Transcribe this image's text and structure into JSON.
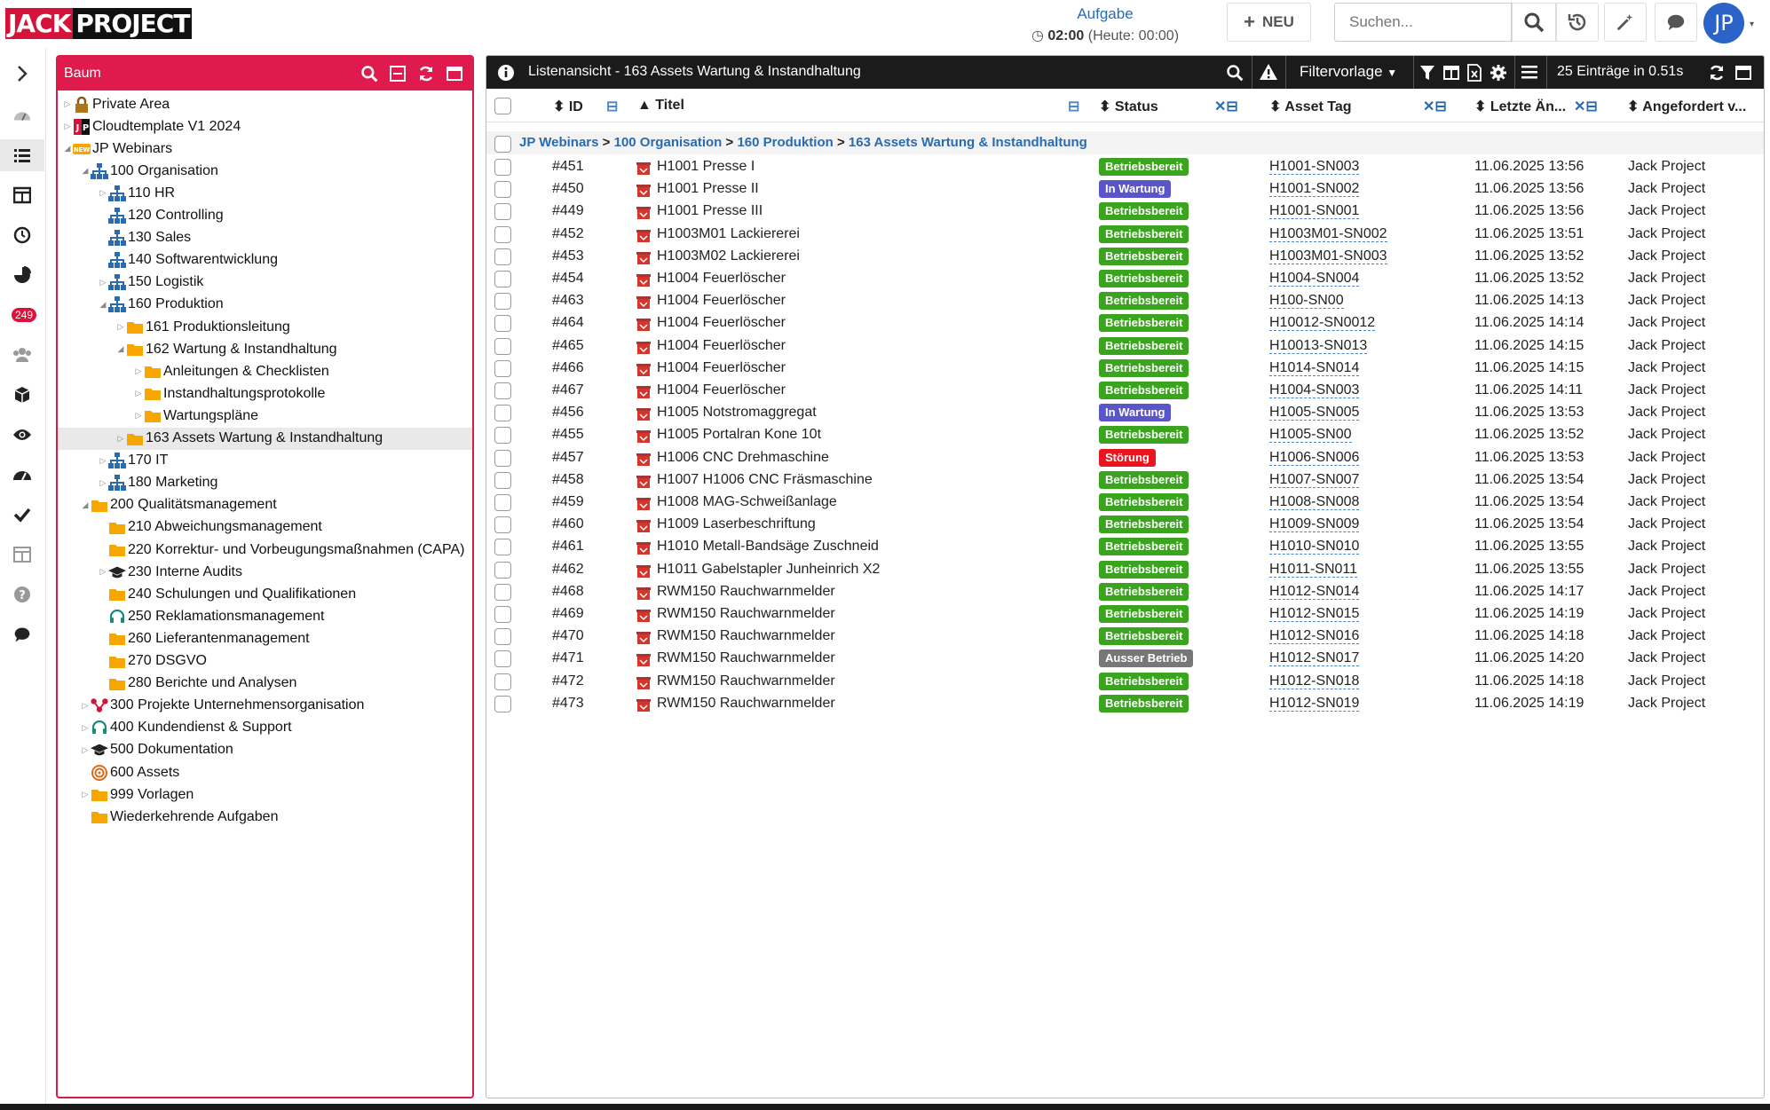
{
  "app": {
    "logo_part1": "JACK",
    "logo_part2": "PROJECT"
  },
  "topbar": {
    "task_label": "Aufgabe",
    "task_time": "02:00",
    "task_today": "(Heute: 00:00)",
    "new_label": "NEU",
    "search_placeholder": "Suchen...",
    "avatar_initials": "JP"
  },
  "sidebar": {
    "badge": "249"
  },
  "tree": {
    "title": "Baum",
    "nodes": [
      {
        "label": "Private Area",
        "level": 0,
        "toggle": "▷",
        "icon": "lock-icon"
      },
      {
        "label": "Cloudtemplate V1 2024",
        "level": 0,
        "toggle": "▷",
        "icon": "jp-logo-icon"
      },
      {
        "label": "JP Webinars",
        "level": 0,
        "toggle": "◢",
        "icon": "new-badge-icon"
      },
      {
        "label": "100 Organisation",
        "level": 1,
        "toggle": "◢",
        "icon": "org-icon"
      },
      {
        "label": "110 HR",
        "level": 2,
        "toggle": "▷",
        "icon": "org-icon"
      },
      {
        "label": "120 Controlling",
        "level": 2,
        "toggle": "",
        "icon": "org-icon"
      },
      {
        "label": "130 Sales",
        "level": 2,
        "toggle": "",
        "icon": "org-icon"
      },
      {
        "label": "140 Softwarentwicklung",
        "level": 2,
        "toggle": "",
        "icon": "org-icon"
      },
      {
        "label": "150 Logistik",
        "level": 2,
        "toggle": "▷",
        "icon": "org-icon"
      },
      {
        "label": "160 Produktion",
        "level": 2,
        "toggle": "◢",
        "icon": "org-icon"
      },
      {
        "label": "161 Produktionsleitung",
        "level": 3,
        "toggle": "▷",
        "icon": "folder-icon"
      },
      {
        "label": "162 Wartung & Instandhaltung",
        "level": 3,
        "toggle": "◢",
        "icon": "folder-icon"
      },
      {
        "label": "Anleitungen & Checklisten",
        "level": 4,
        "toggle": "▷",
        "icon": "folder-icon"
      },
      {
        "label": "Instandhaltungsprotokolle",
        "level": 4,
        "toggle": "▷",
        "icon": "folder-icon"
      },
      {
        "label": "Wartungspläne",
        "level": 4,
        "toggle": "▷",
        "icon": "folder-icon"
      },
      {
        "label": "163 Assets Wartung & Instandhaltung",
        "level": 3,
        "toggle": "▷",
        "icon": "folder-icon",
        "selected": true
      },
      {
        "label": "170 IT",
        "level": 2,
        "toggle": "▷",
        "icon": "org-icon"
      },
      {
        "label": "180 Marketing",
        "level": 2,
        "toggle": "▷",
        "icon": "org-icon"
      },
      {
        "label": "200 Qualitätsmanagement",
        "level": 1,
        "toggle": "◢",
        "icon": "folder-icon"
      },
      {
        "label": "210 Abweichungsmanagement",
        "level": 2,
        "toggle": "",
        "icon": "folder-icon"
      },
      {
        "label": "220 Korrektur- und Vorbeugungsmaßnahmen (CAPA)",
        "level": 2,
        "toggle": "",
        "icon": "folder-icon"
      },
      {
        "label": "230 Interne Audits",
        "level": 2,
        "toggle": "▷",
        "icon": "graduation-icon"
      },
      {
        "label": "240 Schulungen und Qualifikationen",
        "level": 2,
        "toggle": "",
        "icon": "folder-icon"
      },
      {
        "label": "250 Reklamationsmanagement",
        "level": 2,
        "toggle": "",
        "icon": "headset-icon"
      },
      {
        "label": "260 Lieferantenmanagement",
        "level": 2,
        "toggle": "",
        "icon": "folder-icon"
      },
      {
        "label": "270 DSGVO",
        "level": 2,
        "toggle": "",
        "icon": "folder-icon"
      },
      {
        "label": "280 Berichte und Analysen",
        "level": 2,
        "toggle": "",
        "icon": "folder-icon"
      },
      {
        "label": "300 Projekte Unternehmensorganisation",
        "level": 1,
        "toggle": "▷",
        "icon": "project-icon"
      },
      {
        "label": "400 Kundendienst & Support",
        "level": 1,
        "toggle": "▷",
        "icon": "headset-icon"
      },
      {
        "label": "500 Dokumentation",
        "level": 1,
        "toggle": "▷",
        "icon": "graduation-icon"
      },
      {
        "label": "600 Assets",
        "level": 1,
        "toggle": "",
        "icon": "target-icon"
      },
      {
        "label": "999 Vorlagen",
        "level": 1,
        "toggle": "▷",
        "icon": "folder-icon"
      },
      {
        "label": "Wiederkehrende Aufgaben",
        "level": 1,
        "toggle": "",
        "icon": "folder-icon"
      }
    ]
  },
  "list": {
    "title": "Listenansicht - 163 Assets Wartung & Instandhaltung",
    "filter_label": "Filtervorlage",
    "count_text": "25 Einträge in 0.51s",
    "columns": {
      "id": "ID",
      "title": "Titel",
      "status": "Status",
      "tag": "Asset Tag",
      "changed": "Letzte Än...",
      "requested": "Angefordert v..."
    },
    "breadcrumb": [
      "JP Webinars",
      "100 Organisation",
      "160 Produktion",
      "163 Assets Wartung & Instandhaltung"
    ],
    "status_colors": {
      "Betriebsbereit": "#3aa41f",
      "In Wartung": "#5a55c9",
      "Störung": "#e8141e",
      "Ausser Betrieb": "#777777"
    },
    "rows": [
      {
        "id": "#451",
        "title": "H1001 Presse I",
        "status": "Betriebsbereit",
        "tag": "H1001-SN003",
        "changed": "11.06.2025 13:56",
        "req": "Jack Project"
      },
      {
        "id": "#450",
        "title": "H1001 Presse II",
        "status": "In Wartung",
        "tag": "H1001-SN002",
        "changed": "11.06.2025 13:56",
        "req": "Jack Project"
      },
      {
        "id": "#449",
        "title": "H1001 Presse III",
        "status": "Betriebsbereit",
        "tag": "H1001-SN001",
        "changed": "11.06.2025 13:56",
        "req": "Jack Project"
      },
      {
        "id": "#452",
        "title": "H1003M01 Lackiererei",
        "status": "Betriebsbereit",
        "tag": "H1003M01-SN002",
        "changed": "11.06.2025 13:51",
        "req": "Jack Project"
      },
      {
        "id": "#453",
        "title": "H1003M02 Lackiererei",
        "status": "Betriebsbereit",
        "tag": "H1003M01-SN003",
        "changed": "11.06.2025 13:52",
        "req": "Jack Project"
      },
      {
        "id": "#454",
        "title": "H1004 Feuerlöscher",
        "status": "Betriebsbereit",
        "tag": "H1004-SN004",
        "changed": "11.06.2025 13:52",
        "req": "Jack Project"
      },
      {
        "id": "#463",
        "title": "H1004 Feuerlöscher",
        "status": "Betriebsbereit",
        "tag": "H100-SN00",
        "changed": "11.06.2025 14:13",
        "req": "Jack Project"
      },
      {
        "id": "#464",
        "title": "H1004 Feuerlöscher",
        "status": "Betriebsbereit",
        "tag": "H10012-SN0012",
        "changed": "11.06.2025 14:14",
        "req": "Jack Project"
      },
      {
        "id": "#465",
        "title": "H1004 Feuerlöscher",
        "status": "Betriebsbereit",
        "tag": "H10013-SN013",
        "changed": "11.06.2025 14:15",
        "req": "Jack Project"
      },
      {
        "id": "#466",
        "title": "H1004 Feuerlöscher",
        "status": "Betriebsbereit",
        "tag": "H1014-SN014",
        "changed": "11.06.2025 14:15",
        "req": "Jack Project"
      },
      {
        "id": "#467",
        "title": "H1004 Feuerlöscher",
        "status": "Betriebsbereit",
        "tag": "H1004-SN003",
        "changed": "11.06.2025 14:11",
        "req": "Jack Project"
      },
      {
        "id": "#456",
        "title": "H1005 Notstromaggregat",
        "status": "In Wartung",
        "tag": "H1005-SN005",
        "changed": "11.06.2025 13:53",
        "req": "Jack Project"
      },
      {
        "id": "#455",
        "title": "H1005 Portalran Kone 10t",
        "status": "Betriebsbereit",
        "tag": "H1005-SN00",
        "changed": "11.06.2025 13:52",
        "req": "Jack Project"
      },
      {
        "id": "#457",
        "title": "H1006 CNC Drehmaschine",
        "status": "Störung",
        "tag": "H1006-SN006",
        "changed": "11.06.2025 13:53",
        "req": "Jack Project"
      },
      {
        "id": "#458",
        "title": "H1007 H1006 CNC Fräsmaschine",
        "status": "Betriebsbereit",
        "tag": "H1007-SN007",
        "changed": "11.06.2025 13:54",
        "req": "Jack Project"
      },
      {
        "id": "#459",
        "title": "H1008 MAG-Schweißanlage",
        "status": "Betriebsbereit",
        "tag": "H1008-SN008",
        "changed": "11.06.2025 13:54",
        "req": "Jack Project"
      },
      {
        "id": "#460",
        "title": "H1009 Laserbeschriftung",
        "status": "Betriebsbereit",
        "tag": "H1009-SN009",
        "changed": "11.06.2025 13:54",
        "req": "Jack Project"
      },
      {
        "id": "#461",
        "title": "H1010 Metall-Bandsäge Zuschneid",
        "status": "Betriebsbereit",
        "tag": "H1010-SN010",
        "changed": "11.06.2025 13:55",
        "req": "Jack Project"
      },
      {
        "id": "#462",
        "title": "H1011 Gabelstapler Junheinrich X2",
        "status": "Betriebsbereit",
        "tag": "H1011-SN011",
        "changed": "11.06.2025 13:55",
        "req": "Jack Project"
      },
      {
        "id": "#468",
        "title": "RWM150 Rauchwarnmelder",
        "status": "Betriebsbereit",
        "tag": "H1012-SN014",
        "changed": "11.06.2025 14:17",
        "req": "Jack Project"
      },
      {
        "id": "#469",
        "title": "RWM150 Rauchwarnmelder",
        "status": "Betriebsbereit",
        "tag": "H1012-SN015",
        "changed": "11.06.2025 14:19",
        "req": "Jack Project"
      },
      {
        "id": "#470",
        "title": "RWM150 Rauchwarnmelder",
        "status": "Betriebsbereit",
        "tag": "H1012-SN016",
        "changed": "11.06.2025 14:18",
        "req": "Jack Project"
      },
      {
        "id": "#471",
        "title": "RWM150 Rauchwarnmelder",
        "status": "Ausser Betrieb",
        "tag": "H1012-SN017",
        "changed": "11.06.2025 14:20",
        "req": "Jack Project"
      },
      {
        "id": "#472",
        "title": "RWM150 Rauchwarnmelder",
        "status": "Betriebsbereit",
        "tag": "H1012-SN018",
        "changed": "11.06.2025 14:18",
        "req": "Jack Project"
      },
      {
        "id": "#473",
        "title": "RWM150 Rauchwarnmelder",
        "status": "Betriebsbereit",
        "tag": "H1012-SN019",
        "changed": "11.06.2025 14:19",
        "req": "Jack Project"
      }
    ]
  }
}
